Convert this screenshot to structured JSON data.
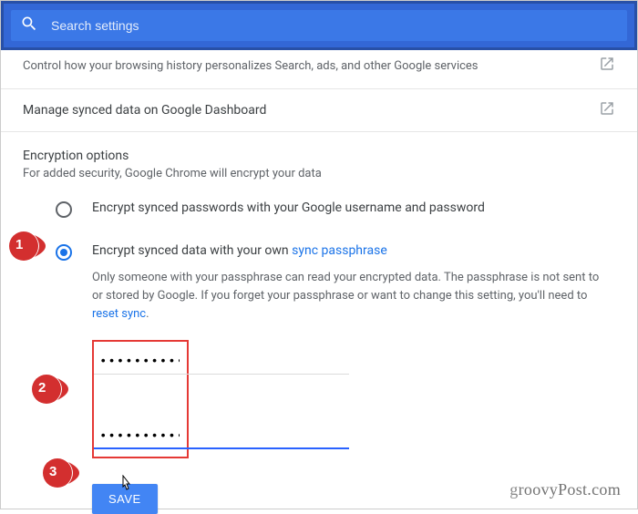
{
  "search": {
    "placeholder": "Search settings",
    "value": ""
  },
  "rows": {
    "activity_desc": "Control how your browsing history personalizes Search, ads, and other Google services",
    "dashboard_label": "Manage synced data on Google Dashboard"
  },
  "encryption": {
    "title": "Encryption options",
    "subtitle": "For added security, Google Chrome will encrypt your data",
    "opt1_label": "Encrypt synced passwords with your Google username and password",
    "opt2_prefix": "Encrypt synced data with your own ",
    "opt2_link": "sync passphrase",
    "opt2_desc_prefix": "Only someone with your passphrase can read your encrypted data. The passphrase is not sent to or stored by Google. If you forget your passphrase or want to change this setting, you'll need to ",
    "opt2_reset_link": "reset sync",
    "opt2_desc_suffix": "."
  },
  "passphrase": {
    "value1": "••••••••••••••",
    "value2": "••••••••••••••"
  },
  "buttons": {
    "save": "SAVE"
  },
  "markers": {
    "m1": "1",
    "m2": "2",
    "m3": "3"
  },
  "watermark": {
    "text_g": "g",
    "text_rest": "roovyPost.com"
  }
}
